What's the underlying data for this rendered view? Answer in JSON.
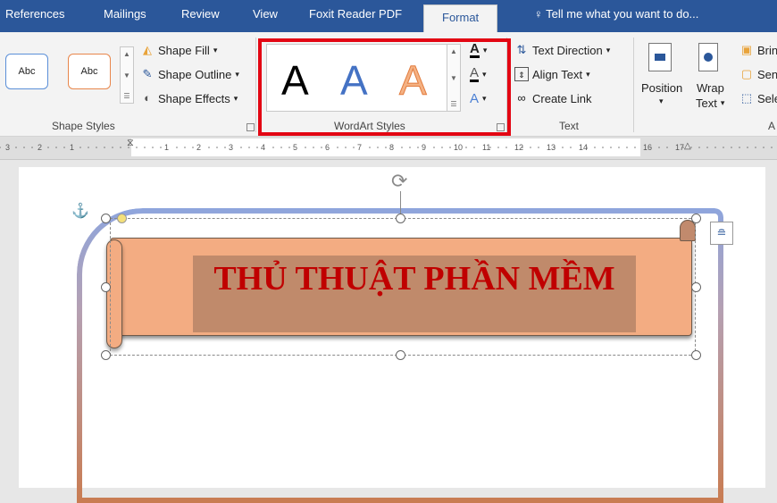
{
  "tabs": [
    "References",
    "Mailings",
    "Review",
    "View",
    "Foxit Reader PDF",
    "Format"
  ],
  "active_tab": "Format",
  "tell_me": "Tell me what you want to do...",
  "shape_styles": {
    "gallery": [
      "Abc",
      "Abc"
    ],
    "fill": "Shape Fill",
    "outline": "Shape Outline",
    "effects": "Shape Effects",
    "label": "Shape Styles"
  },
  "wordart": {
    "samples": [
      "A",
      "A",
      "A"
    ],
    "label": "WordArt Styles"
  },
  "text_group": {
    "direction": "Text Direction",
    "align": "Align Text",
    "link": "Create Link",
    "label": "Text"
  },
  "arrange": {
    "position": "Position",
    "wrap": "Wrap",
    "wrap2": "Text",
    "bring": "Brin",
    "send": "Sen",
    "select": "Sele",
    "label": "A"
  },
  "ruler": [
    "3",
    "2",
    "1",
    "1",
    "2",
    "3",
    "4",
    "5",
    "6",
    "7",
    "8",
    "9",
    "10",
    "11",
    "12",
    "13",
    "14",
    "16",
    "17"
  ],
  "document": {
    "wordart_text": "THỦ THUẬT PHẦN MỀM"
  },
  "colors": {
    "ribbon_tab": "#2b579a",
    "highlight": "#e30613",
    "wordart_text": "#c00000",
    "scroll_fill": "#f3ac82"
  }
}
